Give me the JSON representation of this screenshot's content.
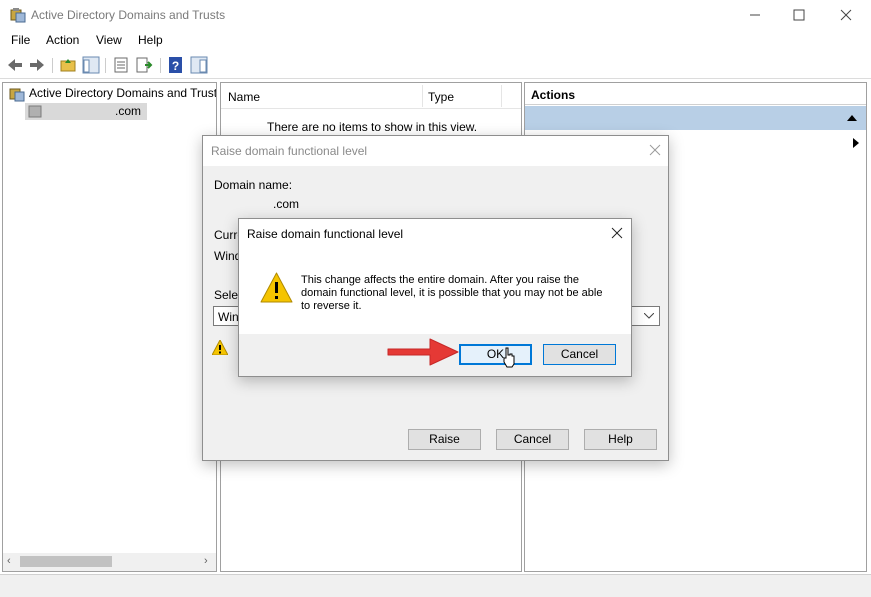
{
  "window": {
    "title": "Active Directory Domains and Trusts"
  },
  "menu": [
    "File",
    "Action",
    "View",
    "Help"
  ],
  "tree": {
    "root_label": "Active Directory Domains and Trusts",
    "domain_label": ".com"
  },
  "list": {
    "columns": [
      "Name",
      "Type"
    ],
    "empty_text": "There are no items to show in this view."
  },
  "actions": {
    "header": "Actions"
  },
  "outer_dialog": {
    "title": "Raise domain functional level",
    "domain_name_label": "Domain name:",
    "domain_name_value": ".com",
    "current_label_partial": "Curre",
    "current_value_partial": "Wind",
    "select_label_partial": "Selec",
    "select_value_partial": "Wind",
    "buttons": {
      "raise": "Raise",
      "cancel": "Cancel",
      "help": "Help"
    }
  },
  "inner_dialog": {
    "title": "Raise domain functional level",
    "message": "This change affects the entire domain. After you raise the domain functional level, it is possible that you may not be able to reverse it.",
    "buttons": {
      "ok": "OK",
      "cancel": "Cancel"
    }
  },
  "colors": {
    "accent": "#0078d7",
    "arrow": "#e53935",
    "warning": "#f5c400"
  }
}
